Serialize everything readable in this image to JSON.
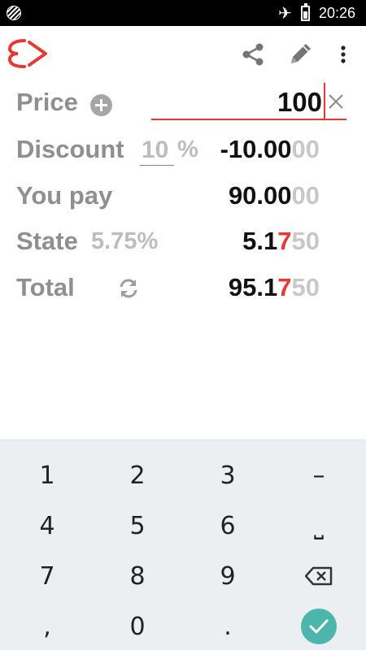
{
  "status_bar": {
    "time": "20:26",
    "icons": [
      "notification-icon",
      "airplane-mode-icon",
      "battery-icon"
    ]
  },
  "app_bar": {
    "logo": "app-logo",
    "actions": [
      "share-icon",
      "pencil-icon",
      "more-vert-icon"
    ]
  },
  "price": {
    "label": "Price",
    "value": "100",
    "add_icon": "plus-icon",
    "clear_icon": "close-icon"
  },
  "discount": {
    "label": "Discount",
    "percent": "10",
    "percent_sign": "%",
    "amount_main": "-10.00",
    "amount_extra": "00"
  },
  "you_pay": {
    "label": "You pay",
    "amount_main": "90.00",
    "amount_extra": "00"
  },
  "state_tax": {
    "label": "State",
    "rate": "5.75%",
    "amount_a": "5.1",
    "amount_b": "7",
    "amount_c": "50"
  },
  "total": {
    "label": "Total",
    "refresh_icon": "refresh-icon",
    "amount_a": "95.1",
    "amount_b": "7",
    "amount_c": "50"
  },
  "keypad": {
    "k1": "1",
    "k2": "2",
    "k3": "3",
    "minus": "–",
    "k4": "4",
    "k5": "5",
    "k6": "6",
    "space": "⎵",
    "k7": "7",
    "k8": "8",
    "k9": "9",
    "backspace_icon": "backspace-icon",
    "comma": ",",
    "k0": "0",
    "dot": ".",
    "done_icon": "check-icon"
  },
  "colors": {
    "accent": "#e53935",
    "label_gray": "#8f8f8f",
    "faint_gray": "#c8c8c8",
    "keypad_bg": "#eceff1",
    "done_teal": "#4db6ac"
  }
}
